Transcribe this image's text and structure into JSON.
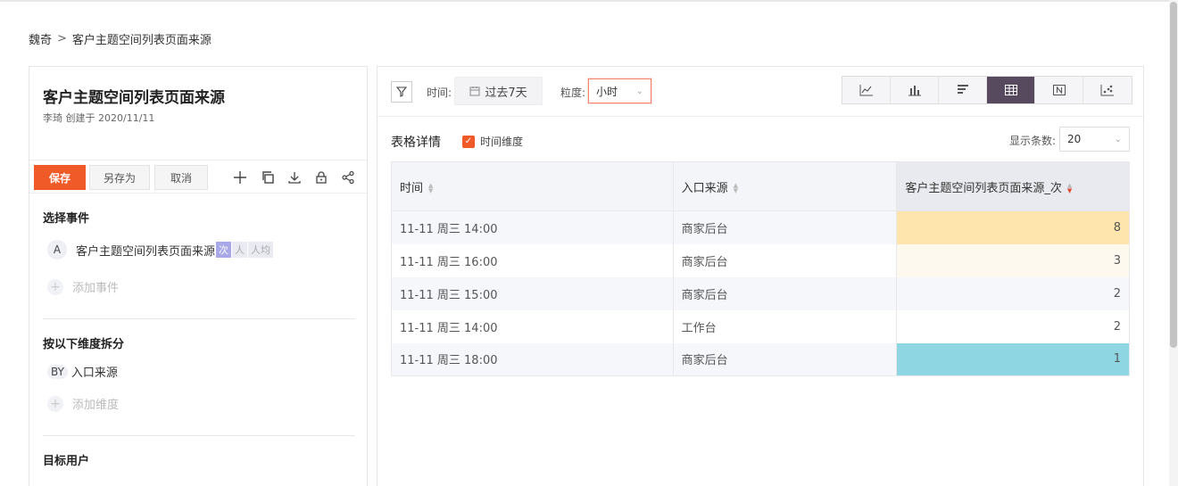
{
  "breadcrumb": {
    "root": "魏奇",
    "separator": ">",
    "current": "客户主题空间列表页面来源"
  },
  "report": {
    "title": "客户主题空间列表页面来源",
    "created_by": "李琦 创建于 2020/11/11"
  },
  "toolbar": {
    "save_label": "保存",
    "save_as_label": "另存为",
    "cancel_label": "取消",
    "icons": [
      "plus-icon",
      "copy-icon",
      "download-icon",
      "lock-icon",
      "share-icon"
    ]
  },
  "events_section": {
    "title": "选择事件",
    "event_badge": "A",
    "event_name": "客户主题空间列表页面来源",
    "metric_tags": [
      "次",
      "人",
      "人均"
    ],
    "active_tag": "次",
    "add_label": "添加事件"
  },
  "dimension_section": {
    "title": "按以下维度拆分",
    "by_badge": "BY",
    "dimension": "入口来源",
    "add_label": "添加维度"
  },
  "target_section": {
    "title": "目标用户"
  },
  "filters": {
    "time_label": "时间:",
    "time_value": "过去7天",
    "granularity_label": "粒度:",
    "granularity_value": "小时"
  },
  "chart_types": [
    {
      "name": "line-chart-icon",
      "active": false
    },
    {
      "name": "bar-chart-icon",
      "active": false
    },
    {
      "name": "horizontal-bar-icon",
      "active": false
    },
    {
      "name": "table-icon",
      "active": true
    },
    {
      "name": "number-icon",
      "active": false
    },
    {
      "name": "scatter-icon",
      "active": false
    }
  ],
  "table_panel": {
    "title": "表格详情",
    "time_dimension_label": "时间维度",
    "time_dimension_checked": true,
    "rows_label": "显示条数:",
    "rows_value": "20"
  },
  "table": {
    "headers": [
      "时间",
      "入口来源",
      "客户主题空间列表页面来源_次"
    ],
    "rows": [
      {
        "time": "11-11 周三 14:00",
        "source": "商家后台",
        "count": "8",
        "heat": "#fde5ad"
      },
      {
        "time": "11-11 周三 16:00",
        "source": "商家后台",
        "count": "3",
        "heat": "#fef9ee"
      },
      {
        "time": "11-11 周三 15:00",
        "source": "商家后台",
        "count": "2",
        "heat": "#f6f7fb"
      },
      {
        "time": "11-11 周三 14:00",
        "source": "工作台",
        "count": "2",
        "heat": "#ffffff"
      },
      {
        "time": "11-11 周三 18:00",
        "source": "商家后台",
        "count": "1",
        "heat": "#8dd6e2"
      }
    ]
  },
  "colors": {
    "primary": "#f05a28",
    "active_chart_btn": "#584a5e",
    "tag_active": "#a8a7e8"
  }
}
